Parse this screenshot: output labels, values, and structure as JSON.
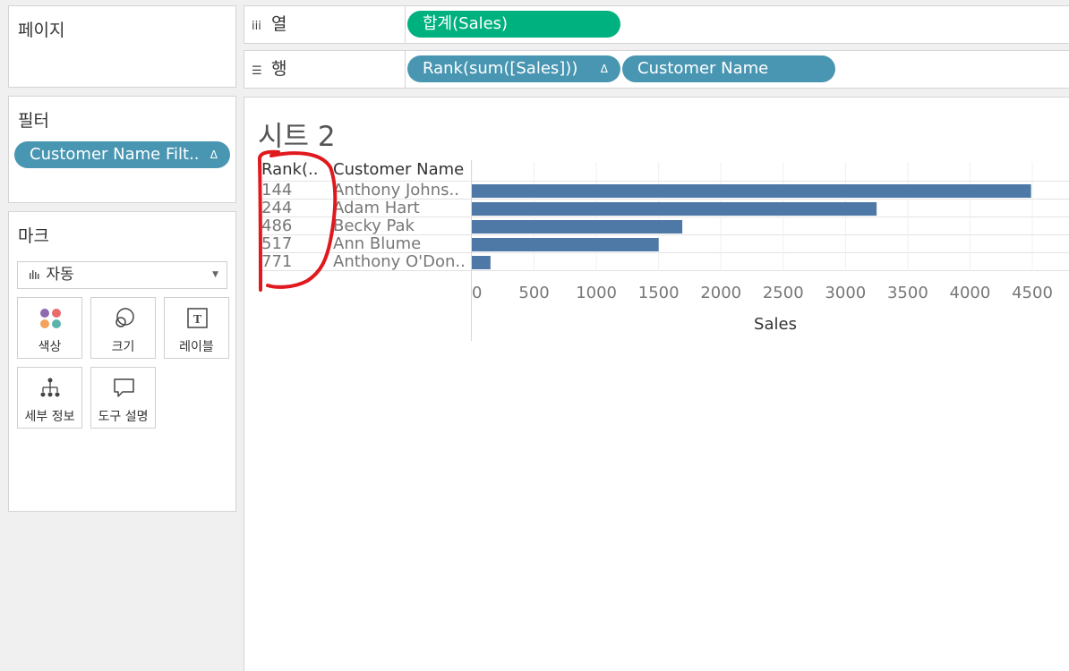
{
  "pages_panel": {
    "title": "페이지"
  },
  "filters_panel": {
    "title": "필터",
    "pill_label": "Customer Name Filt..",
    "pill_indicator": "Δ"
  },
  "marks_panel": {
    "title": "마크",
    "mark_type": "자동",
    "mark_type_icon": "bar-chart-icon",
    "cards": [
      {
        "label": "색상",
        "icon": "color-dots-icon"
      },
      {
        "label": "크기",
        "icon": "size-circles-icon"
      },
      {
        "label": "레이블",
        "icon": "text-label-icon"
      },
      {
        "label": "세부 정보",
        "icon": "hierarchy-icon"
      },
      {
        "label": "도구 설명",
        "icon": "speech-bubble-icon"
      }
    ]
  },
  "shelves": {
    "columns": {
      "label": "열",
      "icon": "columns-icon",
      "pills": [
        {
          "label": "합계(Sales)"
        }
      ]
    },
    "rows": {
      "label": "행",
      "icon": "rows-icon",
      "pills": [
        {
          "label": "Rank(sum([Sales]))",
          "indicator": "Δ"
        },
        {
          "label": "Customer Name"
        }
      ]
    }
  },
  "sheet": {
    "title": "시트 2",
    "headers": {
      "rank": "Rank(..",
      "customer": "Customer Name"
    }
  },
  "colors": {
    "bar": "#4e79a7",
    "pill_blue": "#4996b2",
    "pill_green": "#00b180",
    "annotation": "#e0191e"
  },
  "chart_data": {
    "type": "bar",
    "orientation": "horizontal",
    "rows": [
      {
        "rank": "144",
        "customer": "Anthony Johns..",
        "value": 4490
      },
      {
        "rank": "244",
        "customer": "Adam Hart",
        "value": 3250
      },
      {
        "rank": "486",
        "customer": "Becky Pak",
        "value": 1690
      },
      {
        "rank": "517",
        "customer": "Ann Blume",
        "value": 1500
      },
      {
        "rank": "771",
        "customer": "Anthony O'Don..",
        "value": 150
      }
    ],
    "xlabel": "Sales",
    "xlim": [
      0,
      4650
    ],
    "xticks": [
      0,
      500,
      1000,
      1500,
      2000,
      2500,
      3000,
      3500,
      4000,
      4500
    ],
    "grid": true
  }
}
